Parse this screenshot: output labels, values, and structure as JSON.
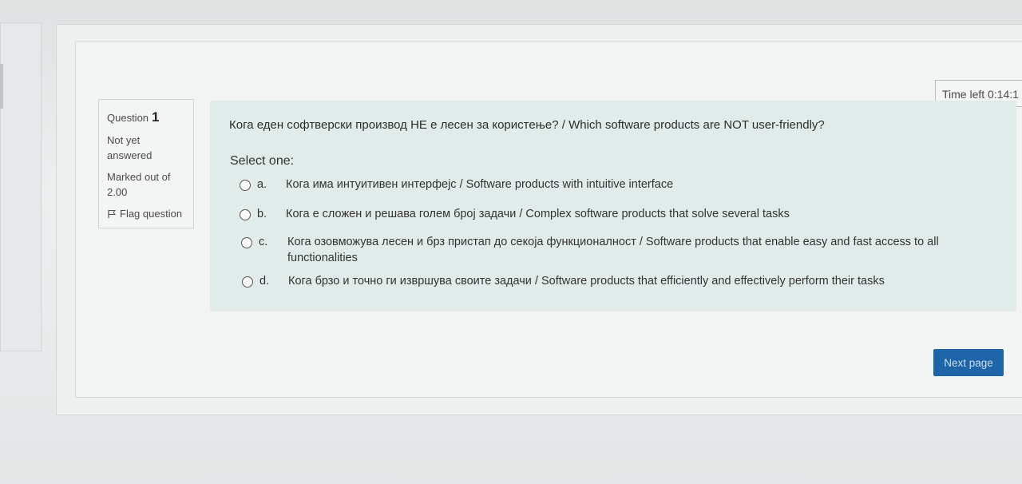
{
  "timer": {
    "text": "Time left 0:14:1"
  },
  "info": {
    "question_label": "Question",
    "question_number": "1",
    "state": "Not yet answered",
    "grade": "Marked out of 2.00",
    "flag_label": "Flag question"
  },
  "question": {
    "text": "Кога еден софтверски производ НЕ е лесен за користење? / Which software products are NOT user-friendly?",
    "prompt": "Select one:",
    "options": [
      {
        "letter": "a.",
        "text": "Кога има интуитивен интерфејс / Software products with intuitive interface",
        "selected": false
      },
      {
        "letter": "b.",
        "text": "Кога е сложен и решава голем број задачи / Complex software products that solve several tasks",
        "selected": false
      },
      {
        "letter": "c.",
        "text": "Кога озовможува лесен и брз пристап до секоја функционалност / Software products that enable easy and fast access to all functionalities",
        "selected": false
      },
      {
        "letter": "d.",
        "text": "Кога брзо и точно ги извршува своите задачи / Software products that efficiently and effectively perform their tasks",
        "selected": false
      }
    ]
  },
  "navigation": {
    "next_label": "Next page"
  },
  "colors": {
    "next_button": "#1d65a8",
    "formulation_bg": "#e1ebea"
  },
  "icons": {
    "flag": "flag-icon",
    "radio": "radio-icon"
  }
}
